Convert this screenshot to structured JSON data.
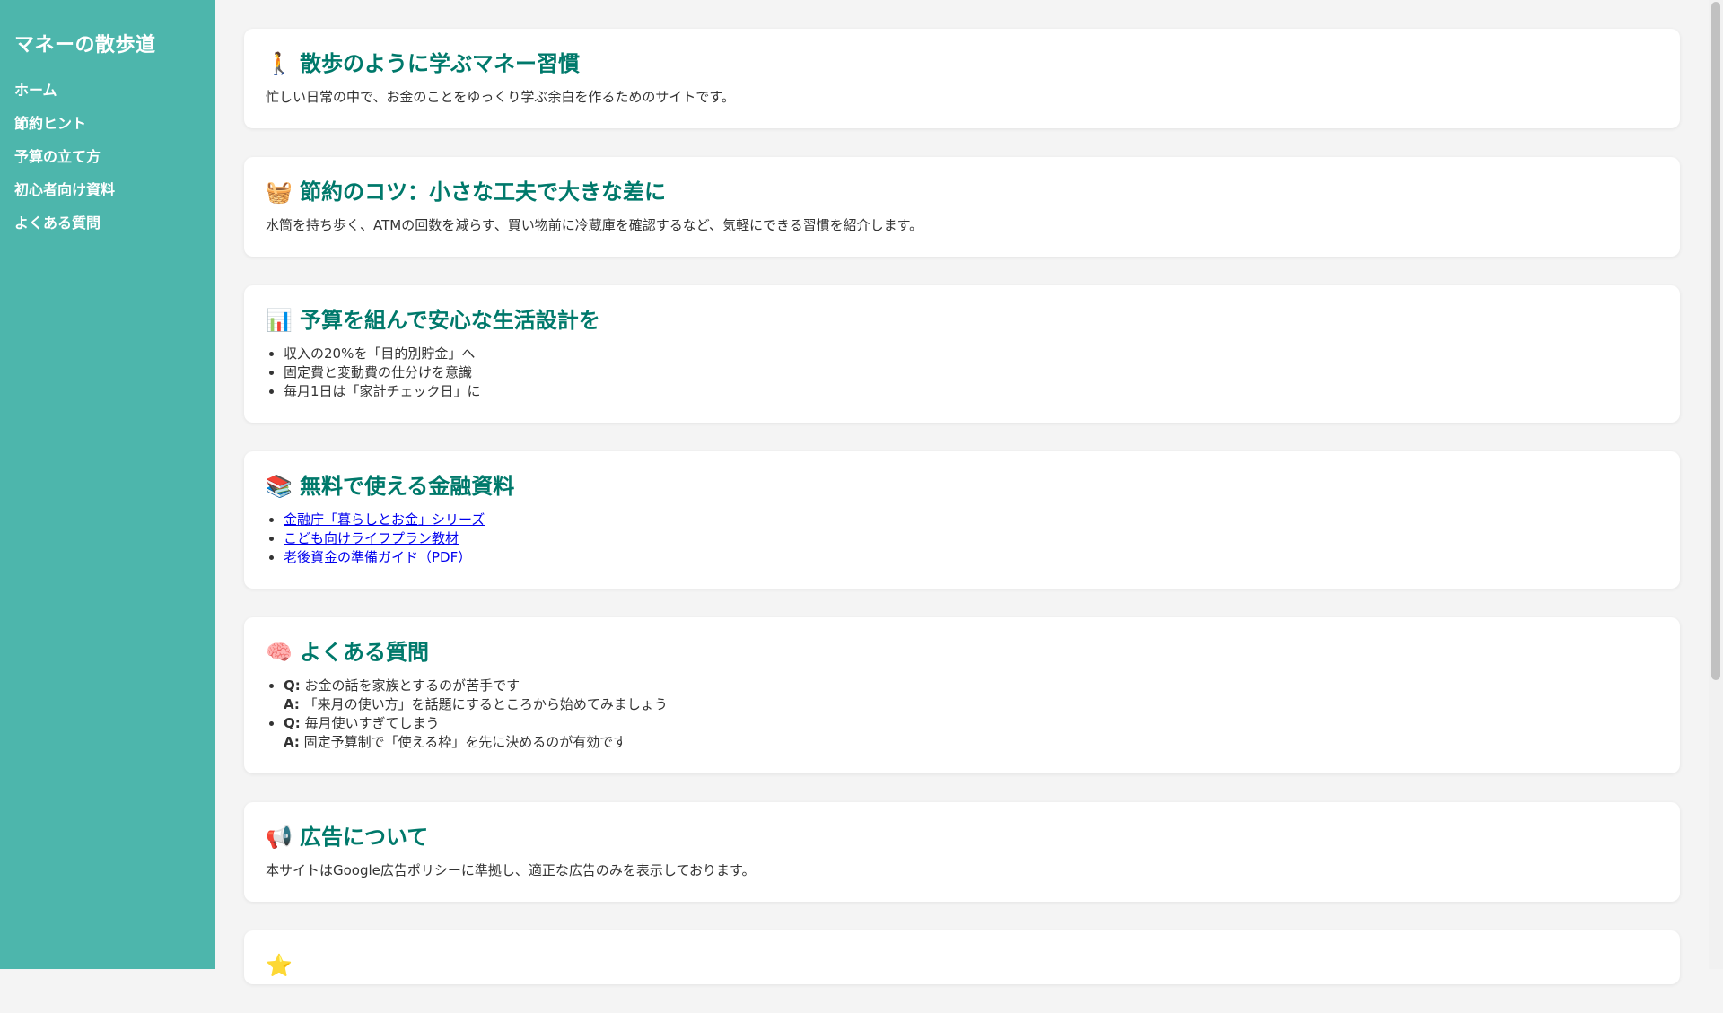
{
  "sidebar": {
    "title": "マネーの散歩道",
    "items": [
      {
        "label": "ホーム"
      },
      {
        "label": "節約ヒント"
      },
      {
        "label": "予算の立て方"
      },
      {
        "label": "初心者向け資料"
      },
      {
        "label": "よくある質問"
      }
    ]
  },
  "sections": {
    "intro": {
      "icon": "walking-person-icon",
      "emoji": "🚶",
      "title": "散歩のように学ぶマネー習慣",
      "text": "忙しい日常の中で、お金のことをゆっくり学ぶ余白を作るためのサイトです。"
    },
    "saving": {
      "icon": "basket-icon",
      "emoji": "🧺",
      "title": "節約のコツ：小さな工夫で大きな差に",
      "text": "水筒を持ち歩く、ATMの回数を減らす、買い物前に冷蔵庫を確認するなど、気軽にできる習慣を紹介します。"
    },
    "budget": {
      "icon": "bar-chart-icon",
      "emoji": "📊",
      "title": "予算を組んで安心な生活設計を",
      "items": [
        "収入の20%を「目的別貯金」へ",
        "固定費と変動費の仕分けを意識",
        "毎月1日は「家計チェック日」に"
      ]
    },
    "resources": {
      "icon": "books-icon",
      "emoji": "📚",
      "title": "無料で使える金融資料",
      "links": [
        "金融庁「暮らしとお金」シリーズ",
        "こども向けライフプラン教材",
        "老後資金の準備ガイド（PDF）"
      ]
    },
    "faq": {
      "icon": "brain-icon",
      "emoji": "🧠",
      "title": "よくある質問",
      "q_label": "Q:",
      "a_label": "A:",
      "items": [
        {
          "q": "お金の話を家族とするのが苦手です",
          "a": "「来月の使い方」を話題にするところから始めてみましょう"
        },
        {
          "q": "毎月使いすぎてしまう",
          "a": "固定予算制で「使える枠」を先に決めるのが有効です"
        }
      ]
    },
    "ads": {
      "icon": "megaphone-icon",
      "emoji": "📢",
      "title": "広告について",
      "text": "本サイトはGoogle広告ポリシーに準拠し、適正な広告のみを表示しております。"
    },
    "partial": {
      "icon": "star-icon",
      "emoji": "⭐"
    }
  }
}
